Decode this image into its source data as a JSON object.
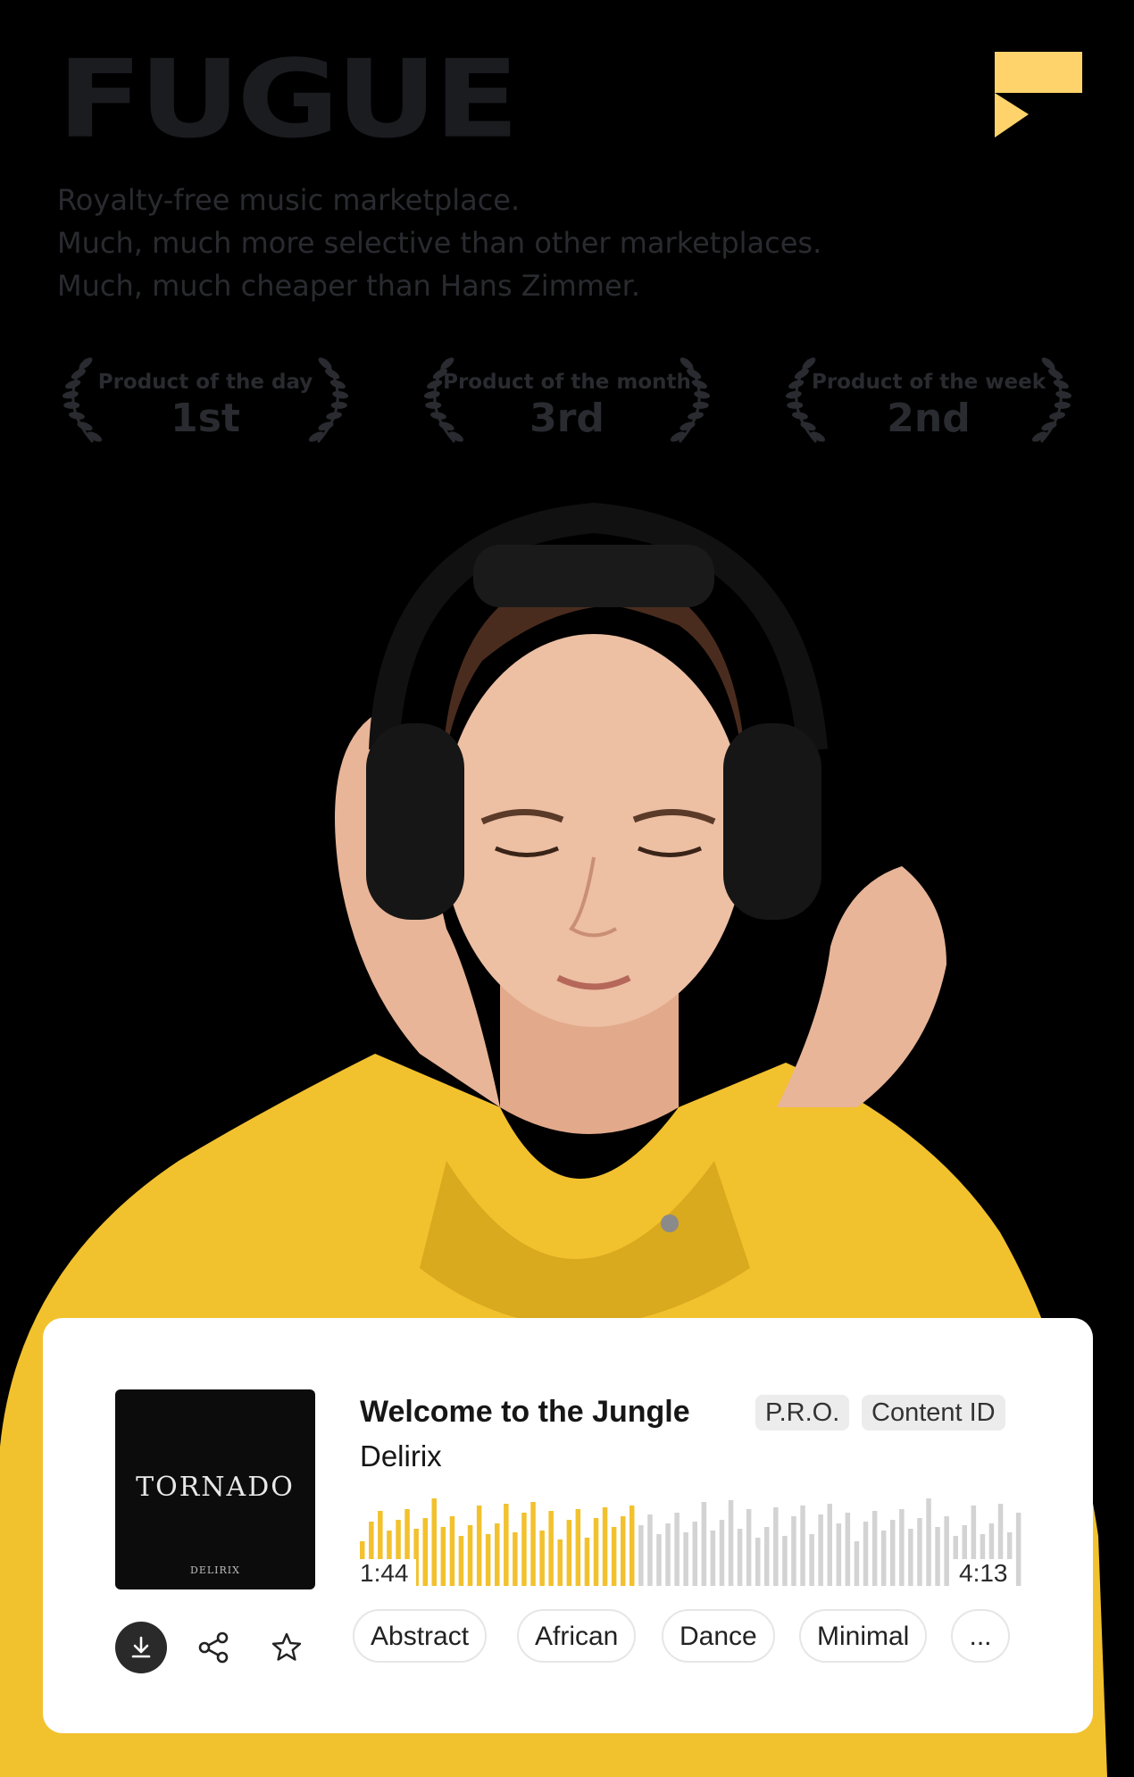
{
  "brand": {
    "name": "FUGUE",
    "accent_color": "#FFD36B"
  },
  "tagline": [
    "Royalty-free music marketplace.",
    "Much, much more selective than other marketplaces.",
    "Much, much cheaper than Hans Zimmer."
  ],
  "awards": [
    {
      "label": "Product of the day",
      "rank": "1st"
    },
    {
      "label": "Product of the month",
      "rank": "3rd"
    },
    {
      "label": "Product of the week",
      "rank": "2nd"
    }
  ],
  "player": {
    "cover_title": "TORNADO",
    "cover_artist": "DELIRIX",
    "track_title": "Welcome to the Jungle",
    "artist": "Delirix",
    "badges": [
      "P.R.O.",
      "Content ID"
    ],
    "elapsed": "1:44",
    "duration": "4:13",
    "progress": 0.411,
    "tags": [
      "Abstract",
      "African",
      "Dance",
      "Minimal",
      "..."
    ],
    "colors": {
      "played": "#F2C12E",
      "unplayed": "#D3D3D3",
      "download_bg": "#2A2A2A"
    },
    "actions": [
      "download-icon",
      "share-icon",
      "star-icon"
    ]
  }
}
